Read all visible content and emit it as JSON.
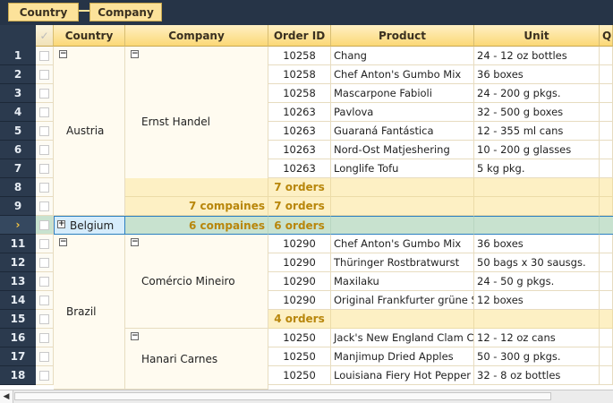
{
  "group_panel": {
    "chips": [
      "Country",
      "Company"
    ]
  },
  "columns": [
    "Country",
    "Company",
    "Order ID",
    "Product",
    "Unit",
    "Q"
  ],
  "row_numbers": [
    "1",
    "2",
    "3",
    "4",
    "5",
    "6",
    "7",
    "8",
    "9",
    "10",
    "11",
    "12",
    "13",
    "14",
    "15",
    "16",
    "17",
    "18"
  ],
  "current_row_indicator": "›",
  "groups": {
    "austria": {
      "country": "Austria",
      "company": "Ernst Handel",
      "company_summary": "7 orders",
      "country_company_count": "7 compaines",
      "country_orders": "7 orders"
    },
    "belgium": {
      "country": "Belgium",
      "company_count": "6 compaines",
      "orders": "6 orders"
    },
    "brazil": {
      "country": "Brazil",
      "company1": "Comércio Mineiro",
      "company1_summary": "4 orders",
      "company2": "Hanari Carnes"
    }
  },
  "rows": [
    {
      "order_id": "10258",
      "product": "Chang",
      "unit": "24 - 12 oz bottles"
    },
    {
      "order_id": "10258",
      "product": "Chef Anton's Gumbo Mix",
      "unit": "36 boxes"
    },
    {
      "order_id": "10258",
      "product": "Mascarpone Fabioli",
      "unit": "24 - 200 g pkgs."
    },
    {
      "order_id": "10263",
      "product": "Pavlova",
      "unit": "32 - 500 g boxes"
    },
    {
      "order_id": "10263",
      "product": "Guaraná Fantástica",
      "unit": "12 - 355 ml cans"
    },
    {
      "order_id": "10263",
      "product": "Nord-Ost Matjeshering",
      "unit": "10 - 200 g glasses"
    },
    {
      "order_id": "10263",
      "product": "Longlife Tofu",
      "unit": "5 kg pkg."
    },
    {
      "order_id": "10290",
      "product": "Chef Anton's Gumbo Mix",
      "unit": "36 boxes"
    },
    {
      "order_id": "10290",
      "product": "Thüringer Rostbratwurst",
      "unit": "50 bags x 30 sausgs."
    },
    {
      "order_id": "10290",
      "product": "Maxilaku",
      "unit": "24 - 50 g pkgs."
    },
    {
      "order_id": "10290",
      "product": "Original Frankfurter grüne Soße",
      "unit": "12 boxes"
    },
    {
      "order_id": "10250",
      "product": "Jack's New England Clam Chowder",
      "unit": "12 - 12 oz cans"
    },
    {
      "order_id": "10250",
      "product": "Manjimup Dried Apples",
      "unit": "50 - 300 g pkgs."
    },
    {
      "order_id": "10250",
      "product": "Louisiana Fiery Hot Pepper Sauce",
      "unit": "32 - 8 oz bottles"
    }
  ],
  "colors": {
    "header_bg": "#fbd876",
    "summary_text": "#b8860b",
    "rownum_bg": "#2b3a4e",
    "selected_row": "#c8e2cf"
  },
  "icons": [
    "check-header-icon",
    "collapse-icon",
    "expand-icon",
    "row-indicator-icon",
    "scroll-left-icon"
  ]
}
